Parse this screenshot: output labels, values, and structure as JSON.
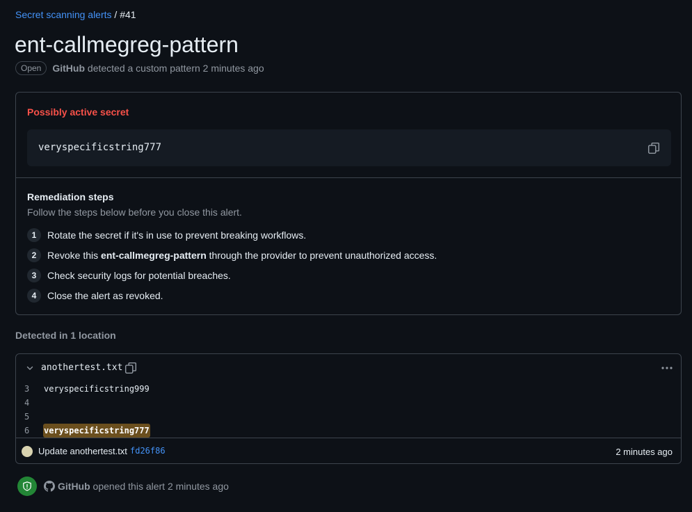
{
  "breadcrumb": {
    "link": "Secret scanning alerts",
    "separator": "/",
    "alert_number": "#41"
  },
  "page_title": "ent-callmegreg-pattern",
  "status": {
    "badge": "Open",
    "actor": "GitHub",
    "text": "detected a custom pattern 2 minutes ago"
  },
  "secret": {
    "validity": "Possibly active secret",
    "value": "veryspecificstring777",
    "copy_icon": "copy-icon"
  },
  "remediation": {
    "title": "Remediation steps",
    "subtitle": "Follow the steps below before you close this alert.",
    "steps": [
      {
        "num": "1",
        "text": "Rotate the secret if it's in use to prevent breaking workflows."
      },
      {
        "num": "2",
        "pre": "Revoke this ",
        "bold": "ent-callmegreg-pattern",
        "post": " through the provider to prevent unauthorized access."
      },
      {
        "num": "3",
        "text": "Check security logs for potential breaches."
      },
      {
        "num": "4",
        "text": "Close the alert as revoked."
      }
    ]
  },
  "locations": {
    "heading": "Detected in 1 location",
    "file": "anothertest.txt",
    "lines": [
      {
        "number": "3",
        "content": "veryspecificstring999",
        "highlighted": false
      },
      {
        "number": "4",
        "content": "",
        "highlighted": false
      },
      {
        "number": "5",
        "content": "",
        "highlighted": false
      },
      {
        "number": "6",
        "content": "veryspecificstring777",
        "highlighted": true
      }
    ],
    "commit_message": "Update anothertest.txt",
    "commit_sha": "fd26f86",
    "commit_time": "2 minutes ago"
  },
  "timeline": {
    "actor": "GitHub",
    "text": "opened this alert 2 minutes ago"
  },
  "colors": {
    "background": "#0d1117",
    "link": "#4493f8",
    "danger": "#f85149",
    "success": "#238636",
    "highlight": "#6b4f1e"
  }
}
